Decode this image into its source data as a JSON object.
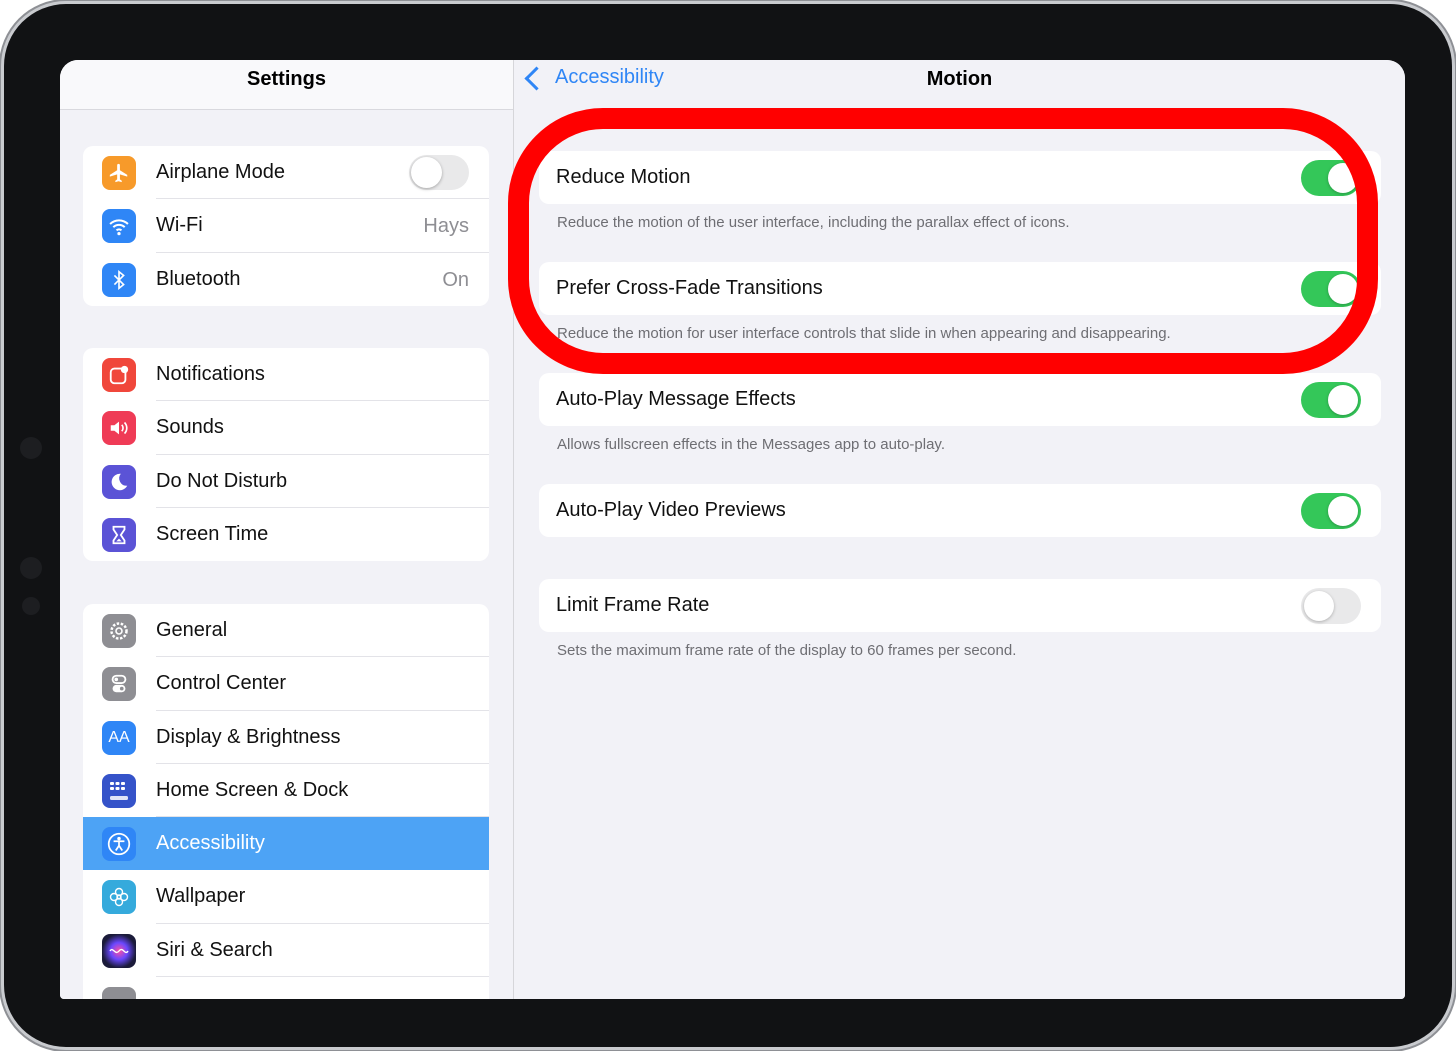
{
  "sidebar": {
    "title": "Settings",
    "group1": [
      {
        "label": "Airplane Mode",
        "icon": "airplane-icon",
        "color": "#f79a2a",
        "toggle": false
      },
      {
        "label": "Wi-Fi",
        "icon": "wifi-icon",
        "color": "#2f86f6",
        "value": "Hays"
      },
      {
        "label": "Bluetooth",
        "icon": "bluetooth-icon",
        "color": "#2f86f6",
        "value": "On"
      }
    ],
    "group2": [
      {
        "label": "Notifications",
        "icon": "notifications-icon",
        "color": "#f0473b"
      },
      {
        "label": "Sounds",
        "icon": "sounds-icon",
        "color": "#ef3b56"
      },
      {
        "label": "Do Not Disturb",
        "icon": "moon-icon",
        "color": "#5b53d6"
      },
      {
        "label": "Screen Time",
        "icon": "hourglass-icon",
        "color": "#5b53d6"
      }
    ],
    "group3": [
      {
        "label": "General",
        "icon": "gear-icon",
        "color": "#8e8e93"
      },
      {
        "label": "Control Center",
        "icon": "control-center-icon",
        "color": "#8e8e93"
      },
      {
        "label": "Display & Brightness",
        "icon": "display-icon",
        "color": "#2f86f6",
        "glyph": "AA"
      },
      {
        "label": "Home Screen & Dock",
        "icon": "home-screen-icon",
        "color": "#3553c9"
      },
      {
        "label": "Accessibility",
        "icon": "accessibility-icon",
        "color": "#2f86f6",
        "selected": true
      },
      {
        "label": "Wallpaper",
        "icon": "wallpaper-icon",
        "color": "#35aadc"
      },
      {
        "label": "Siri & Search",
        "icon": "siri-icon",
        "color": "#1c1c3c"
      }
    ]
  },
  "detail": {
    "back_label": "Accessibility",
    "title": "Motion",
    "items": [
      {
        "label": "Reduce Motion",
        "on": true,
        "footer": "Reduce the motion of the user interface, including the parallax effect of icons."
      },
      {
        "label": "Prefer Cross-Fade Transitions",
        "on": true,
        "footer": "Reduce the motion for user interface controls that slide in when appearing and disappearing."
      },
      {
        "label": "Auto-Play Message Effects",
        "on": true,
        "footer": "Allows fullscreen effects in the Messages app to auto-play."
      },
      {
        "label": "Auto-Play Video Previews",
        "on": true,
        "footer": ""
      },
      {
        "label": "Limit Frame Rate",
        "on": false,
        "footer": "Sets the maximum frame rate of the display to 60 frames per second."
      }
    ]
  },
  "colors": {
    "accent": "#2f86f6",
    "toggle_on": "#34c759",
    "highlight": "#ff0000"
  }
}
